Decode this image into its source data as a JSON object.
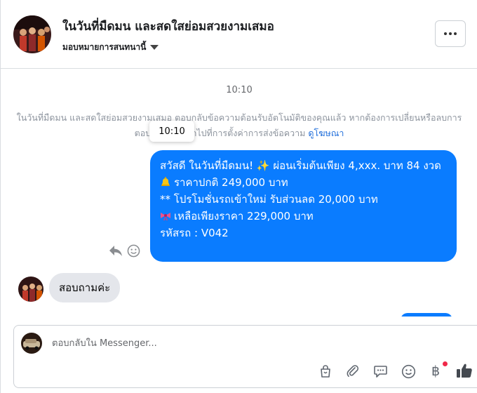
{
  "header": {
    "page_title": "ในวันที่มืดมน และสดใสย่อมสวยงามเสมอ",
    "assign_label": "มอบหมายการสนทนานี้"
  },
  "thread": {
    "timestamp": "10:10",
    "notice_text": "ในวันที่มืดมน และสดใสย่อมสวยงามเสมอ ตอบกลับข้อความต้อนรับอัตโนมัติของคุณแล้ว หากต้องการเปลี่ยนหรือลบการตอบกลับนี้ โปรดไปที่การตั้งค่าการส่งข้อความ",
    "notice_link": "ดูโฆษณา",
    "tooltip_time": "10:10",
    "outgoing_message": {
      "line1": "สวัสดี ในวันที่มืดมน! ✨  ผ่อนเริ่มต้นเพียง 4,xxx. บาท 84 งวด",
      "line2": "ราคาปกติ 249,000 บาท",
      "line3": "** โปรโมชั่นรถเข้าใหม่ รับส่วนลด 20,000 บาท",
      "line4": "เหลือเพียงราคา 229,000 บาท",
      "line5": "รหัสรถ : V042"
    },
    "incoming_message": "สอบถามค่ะ"
  },
  "composer": {
    "placeholder": "ตอบกลับใน Messenger..."
  },
  "icons": [
    "more-icon",
    "caret-down-icon",
    "reply-icon",
    "react-smiley-icon",
    "bell-emoji-icon",
    "ribbon-emoji-icon",
    "shopping-bag-icon",
    "paperclip-icon",
    "saved-reply-icon",
    "emoji-icon",
    "baht-payment-icon",
    "like-thumb-icon"
  ],
  "colors": {
    "outgoing_bubble": "#0a7cff",
    "incoming_bubble": "#e4e6eb",
    "link": "#216fdb",
    "notification_dot": "#f02849"
  }
}
